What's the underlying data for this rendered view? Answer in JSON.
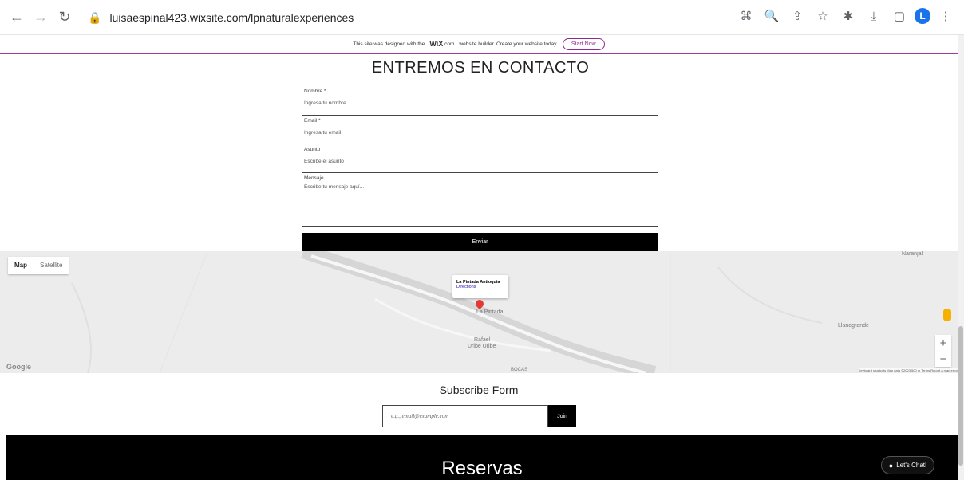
{
  "browser": {
    "url": "luisaespinal423.wixsite.com/lpnaturalexperiences",
    "avatar_letter": "L",
    "icons": [
      "back-arrow-icon",
      "forward-arrow-icon",
      "reload-icon",
      "lock-icon",
      "translate-icon",
      "zoom-icon",
      "share-icon",
      "star-icon",
      "extensions-icon",
      "download-icon",
      "sidepanel-icon",
      "menu-icon"
    ]
  },
  "wix_banner": {
    "text": "This site was designed with the",
    "brand": "WiX",
    "brand_suffix": ".com",
    "text2": "website builder. Create your website today.",
    "start_label": "Start Now"
  },
  "contact": {
    "title": "ENTREMOS EN CONTACTO",
    "fields": [
      {
        "label": "Nombre *",
        "placeholder": "Ingresa tu nombre"
      },
      {
        "label": "Email *",
        "placeholder": "Ingresa tu email"
      },
      {
        "label": "Asunto",
        "placeholder": "Escribe el asunto"
      },
      {
        "label": "Mensaje",
        "placeholder": "Escribe tu mensaje aquí..."
      }
    ],
    "submit_label": "Enviar"
  },
  "map": {
    "type_map": "Map",
    "type_satellite": "Satellite",
    "popup_title": "La Pintada Antioquia",
    "popup_link": "Directions",
    "labels": [
      "La Pintada",
      "Rafael",
      "Uribe Uribe",
      "Naranjal",
      "Llanogrande",
      "BOCAS"
    ],
    "logo": "Google",
    "attribution": "Keyboard shortcuts   Map data ©2023   500 m   Terms   Report a map error"
  },
  "subscribe": {
    "title": "Subscribe Form",
    "placeholder": "e.g., email@example.com",
    "join_label": "Join"
  },
  "footer": {
    "title": "Reservas",
    "chat_label": "Let's Chat!"
  }
}
